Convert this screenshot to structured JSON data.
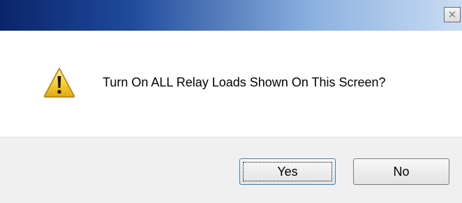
{
  "window": {
    "close_symbol": "✕",
    "title_gradient": [
      "#0a246a",
      "#1f4a9a",
      "#8db2e0",
      "#c9dcf3"
    ]
  },
  "dialog": {
    "icon": "warning-icon",
    "message": "Turn On ALL Relay Loads Shown On This Screen?"
  },
  "buttons": {
    "yes_label": "Yes",
    "no_label": "No"
  }
}
